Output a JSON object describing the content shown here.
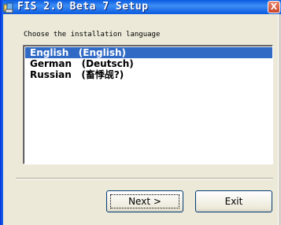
{
  "window": {
    "title": "FIS 2.0 Beta 7 Setup",
    "close_glyph": "X"
  },
  "dialog": {
    "prompt": "Choose the installation language",
    "languages": [
      {
        "label": "English   (English)",
        "selected": true
      },
      {
        "label": "German   (Deutsch)",
        "selected": false
      },
      {
        "label": "Russian   (畜悸觇?)",
        "selected": false
      }
    ]
  },
  "buttons": {
    "next_label": "Next >",
    "exit_label": "Exit"
  },
  "colors": {
    "titlebar": "#0a5be0",
    "selection": "#316ac5",
    "dialog_bg": "#ece9d8",
    "close_button": "#c9442a"
  },
  "icons": {
    "app_icon": "setup-app-icon",
    "close_icon": "close-icon"
  }
}
